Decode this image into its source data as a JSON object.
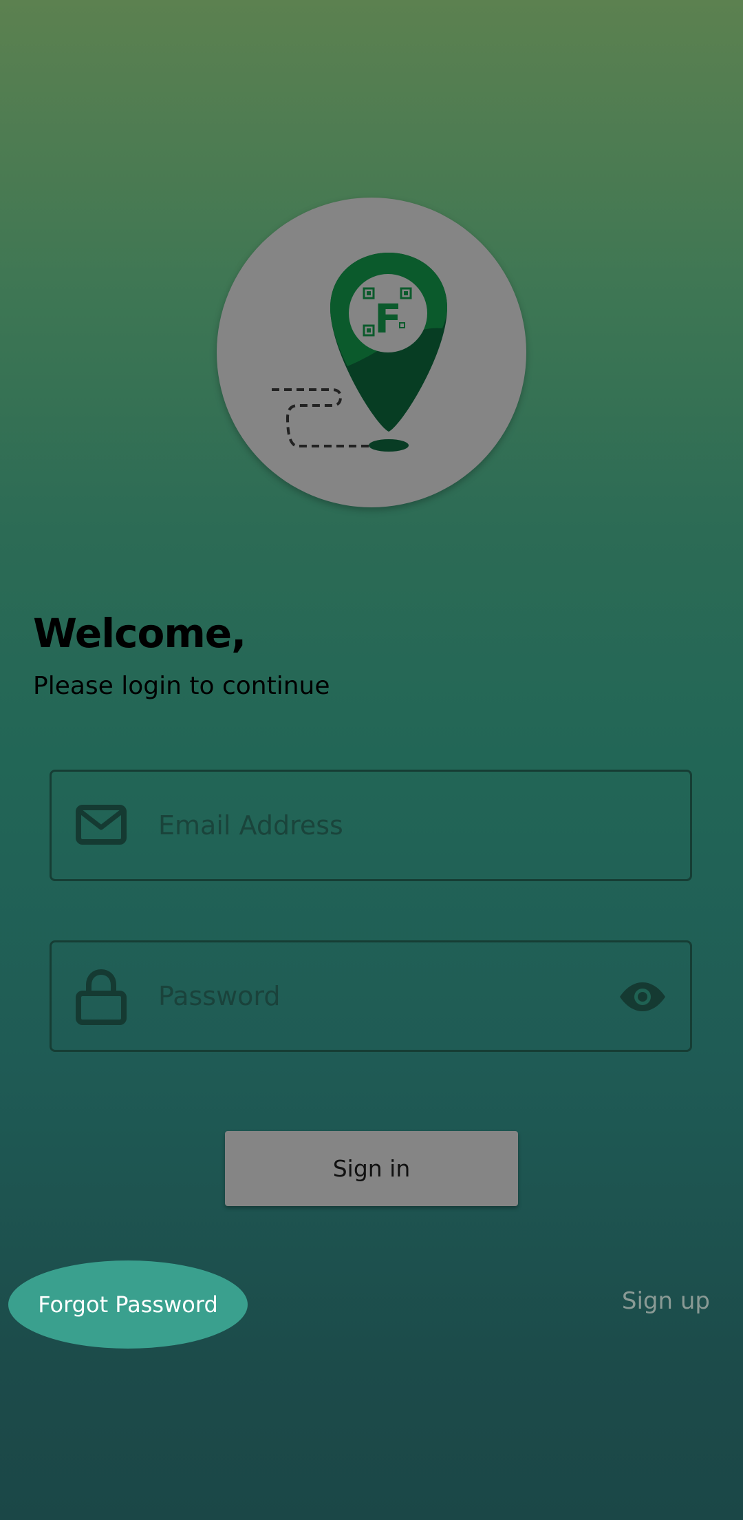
{
  "logo": {
    "name": "app-logo",
    "letter": "F"
  },
  "welcome": {
    "title": "Welcome,",
    "subtitle": "Please login to continue"
  },
  "form": {
    "email_placeholder": "Email Address",
    "password_placeholder": "Password",
    "email_icon": "envelope-icon",
    "password_icon": "lock-icon",
    "toggle_icon": "eye-icon"
  },
  "actions": {
    "signin_label": "Sign in",
    "forgot_label": "Forgot Password",
    "signup_label": "Sign up"
  },
  "colors": {
    "logo_background": "#858585",
    "brand_green": "#0b5a2c",
    "forgot_button": "#3aa08e"
  }
}
